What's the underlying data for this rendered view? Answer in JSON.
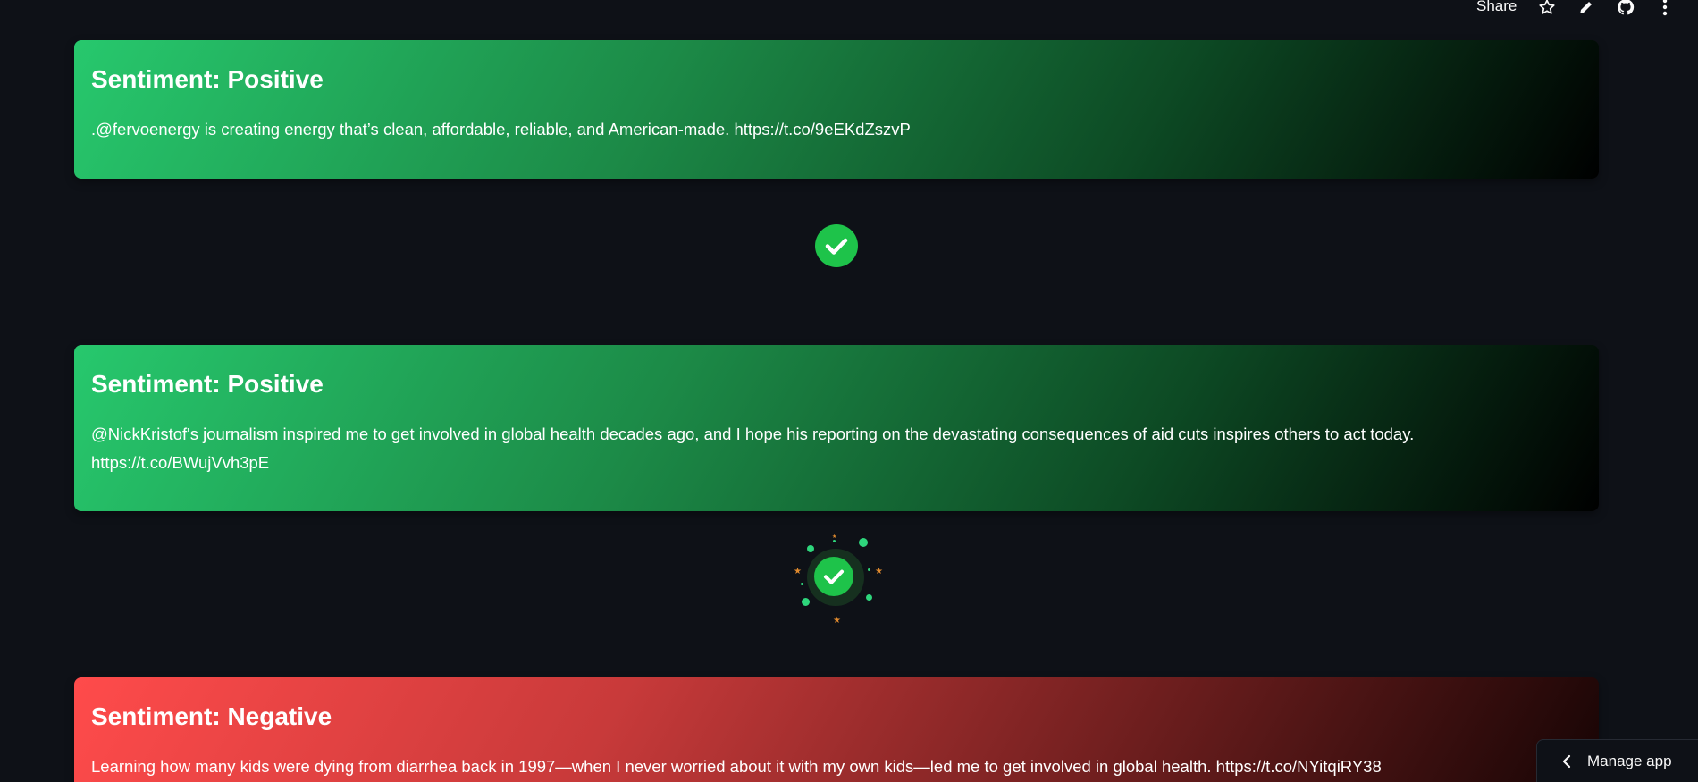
{
  "toolbar": {
    "share_label": "Share",
    "icons": [
      "star-icon",
      "pencil-icon",
      "github-icon",
      "kebab-menu-icon"
    ]
  },
  "cards": [
    {
      "sentiment": "Sentiment: Positive",
      "text": ".@fervoenergy is creating energy that’s clean, affordable, reliable, and American-made. https://t.co/9eEKdZszvP",
      "tone": "positive"
    },
    {
      "sentiment": "Sentiment: Positive",
      "text": "@NickKristof's journalism inspired me to get involved in global health decades ago, and I hope his reporting on the devastating consequences of aid cuts inspires others to act today. https://t.co/BWujVvh3pE",
      "tone": "positive"
    },
    {
      "sentiment": "Sentiment: Negative",
      "text": "Learning how many kids were dying from diarrhea back in 1997—when I never worried about it with my own kids—led me to get involved in global health. https://t.co/NYitqiRY38",
      "tone": "negative"
    }
  ],
  "manage_app": {
    "label": "Manage app"
  },
  "colors": {
    "background": "#0e1117",
    "positive_start": "#27c86d",
    "negative_start": "#ff4b4b",
    "check_green": "#1ec34a"
  }
}
